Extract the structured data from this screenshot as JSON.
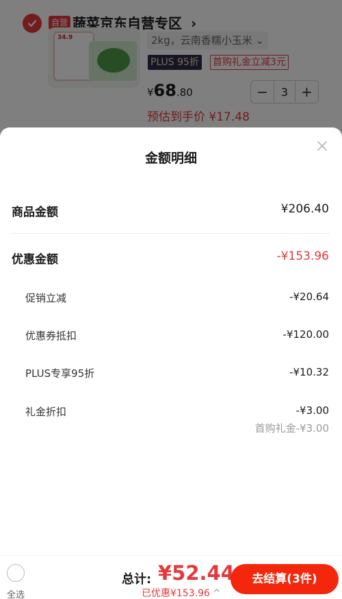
{
  "store": {
    "badge": "自营",
    "name": "蔬菜京东自营专区",
    "chevron": "›"
  },
  "product": {
    "thumb_price": "34.9",
    "spec": "2kg，云南香糯小玉米",
    "spec_chevron": "⌄",
    "plus_tag": "PLUS 95折",
    "coupon_tag": "首购礼金立减3元",
    "price_currency": "¥",
    "price_int": "68",
    "price_dec": ".80",
    "estimate": "预估到手价 ¥17.48",
    "qty": "3",
    "minus": "−",
    "plus": "+"
  },
  "sheet": {
    "title": "金额明细",
    "rows": [
      {
        "label": "商品金额",
        "value": "¥206.40"
      },
      {
        "label": "优惠金额",
        "value": "-¥153.96"
      }
    ],
    "sub_rows": [
      {
        "label": "促销立减",
        "value": "-¥20.64"
      },
      {
        "label": "优惠券抵扣",
        "value": "-¥120.00"
      },
      {
        "label": "PLUS专享95折",
        "value": "-¥10.32"
      },
      {
        "label": "礼金折扣",
        "value": "-¥3.00"
      }
    ],
    "gift_note": "首购礼金-¥3.00"
  },
  "bottom": {
    "select_all": "全选",
    "total_label": "总计:",
    "total_value": "¥52.44",
    "saved": "已优惠¥153.96",
    "saved_chevron": "^",
    "checkout": "去结算(3件)"
  },
  "colors": {
    "accent": "#e4393c",
    "checkout": "#f2270c"
  }
}
